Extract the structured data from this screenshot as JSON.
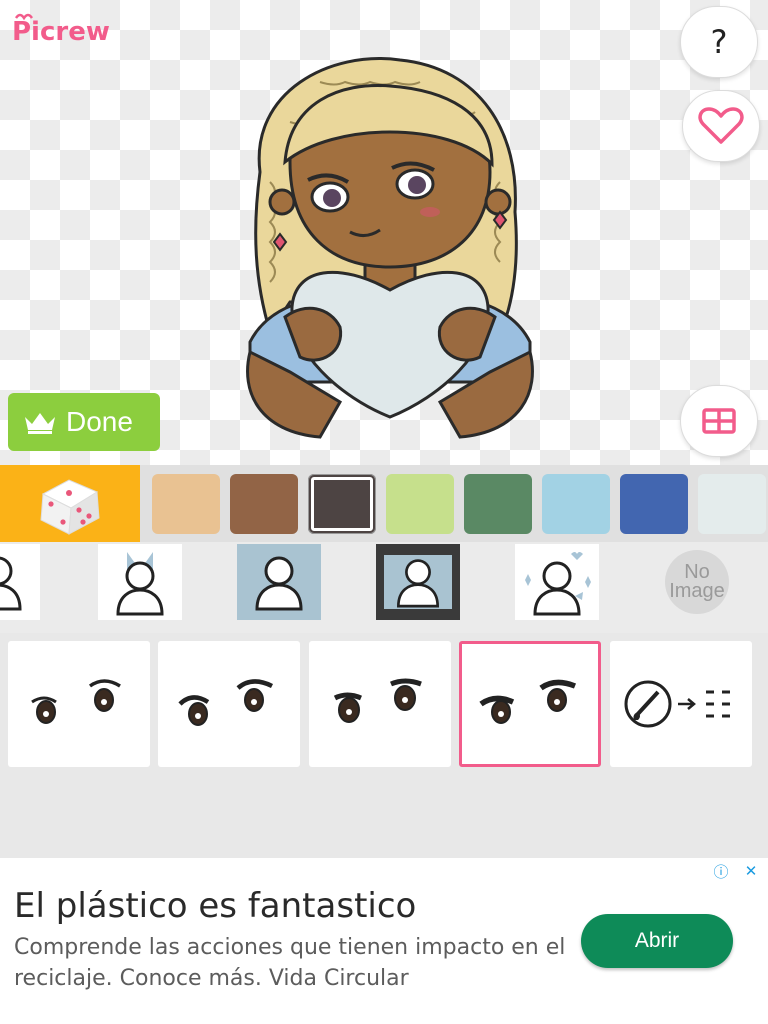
{
  "app": {
    "logo_text": "Picrew",
    "help_label": "?",
    "done_label": "Done"
  },
  "icons": {
    "logo": "picrew-logo",
    "help": "question-mark-icon",
    "favorite": "heart-icon",
    "layout": "grid-icon",
    "done": "crown-icon",
    "randomize": "dice-icon"
  },
  "colors": {
    "accent": "#f25c8b",
    "done_bg": "#8cce3e",
    "dice_bg": "#fbb217",
    "cta_bg": "#0e8b58"
  },
  "palette": {
    "swatches": [
      "#e9c292",
      "#926446",
      "#4d4443",
      "#c6e08c",
      "#5a8964",
      "#a2d2e4",
      "#4266b0",
      "#e4ecec"
    ],
    "selected_index": 2
  },
  "backgrounds": {
    "items": [
      {
        "name": "bg-partial-left"
      },
      {
        "name": "bg-blue-ribbon"
      },
      {
        "name": "bg-light-blue"
      },
      {
        "name": "bg-dark-frame"
      },
      {
        "name": "bg-sparkle-hearts"
      },
      {
        "name": "bg-no-image",
        "label_line1": "No",
        "label_line2": "Image"
      }
    ],
    "selected_index": 2
  },
  "items": {
    "cards": [
      {
        "name": "eye-style-1"
      },
      {
        "name": "eye-style-2"
      },
      {
        "name": "eye-style-3"
      },
      {
        "name": "eye-style-4"
      },
      {
        "name": "custom-color-brush"
      }
    ],
    "selected_index": 3
  },
  "ad": {
    "title": "El plástico es fantastico",
    "description": "Comprende las acciones que tienen impacto en el reciclaje. Conoce más. Vida Circular",
    "cta": "Abrir",
    "info_glyph": "ⓘ",
    "close_glyph": "✕"
  }
}
